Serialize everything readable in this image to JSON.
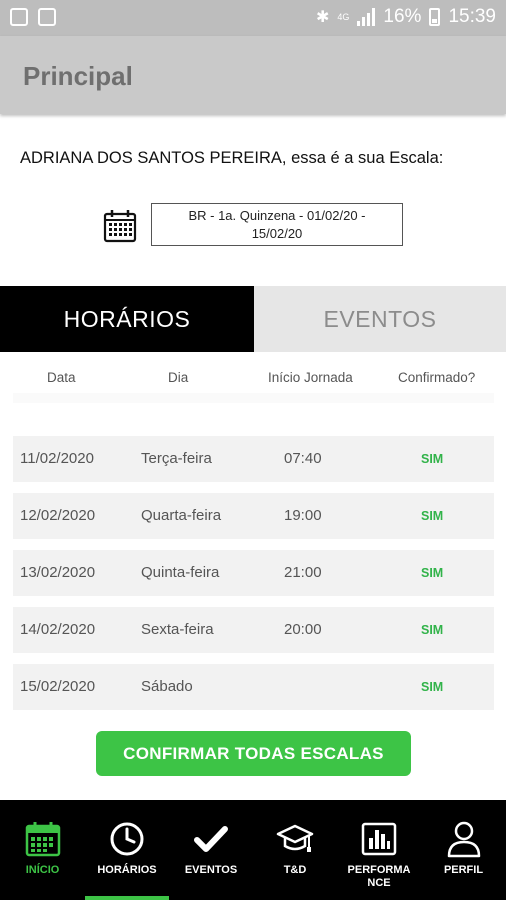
{
  "status": {
    "battery": "16%",
    "time": "15:39",
    "network": "4G"
  },
  "appbar": {
    "title": "Principal"
  },
  "greeting": "ADRIANA DOS SANTOS PEREIRA, essa é a sua Escala:",
  "period": {
    "value": "BR - 1a. Quinzena - 01/02/20 - 15/02/20"
  },
  "tabs": [
    {
      "label": "HORÁRIOS",
      "active": true
    },
    {
      "label": "EVENTOS",
      "active": false
    }
  ],
  "columns": [
    "Data",
    "Dia",
    "Início Jornada",
    "Confirmado?"
  ],
  "rows": [
    {
      "date": "11/02/2020",
      "day": "Terça-feira",
      "start": "07:40",
      "confirmed": "SIM"
    },
    {
      "date": "12/02/2020",
      "day": "Quarta-feira",
      "start": "19:00",
      "confirmed": "SIM"
    },
    {
      "date": "13/02/2020",
      "day": "Quinta-feira",
      "start": "21:00",
      "confirmed": "SIM"
    },
    {
      "date": "14/02/2020",
      "day": "Sexta-feira",
      "start": "20:00",
      "confirmed": "SIM"
    },
    {
      "date": "15/02/2020",
      "day": "Sábado",
      "start": "",
      "confirmed": "SIM"
    }
  ],
  "confirm_button": "CONFIRMAR TODAS ESCALAS",
  "nav": [
    {
      "label": "INÍCIO",
      "icon": "calendar-icon",
      "color": "#3dc446"
    },
    {
      "label": "HORÁRIOS",
      "icon": "clock-icon",
      "color": "#ffffff"
    },
    {
      "label": "EVENTOS",
      "icon": "check-icon",
      "color": "#ffffff"
    },
    {
      "label": "T&D",
      "icon": "graduation-cap-icon",
      "color": "#ffffff"
    },
    {
      "label": "PERFORMANCE",
      "icon": "bar-chart-icon",
      "color": "#ffffff"
    },
    {
      "label": "PERFIL",
      "icon": "user-icon",
      "color": "#ffffff"
    }
  ],
  "colors": {
    "accent": "#3dc446",
    "appbar": "#c9c9c9",
    "tab_active": "#000000"
  }
}
